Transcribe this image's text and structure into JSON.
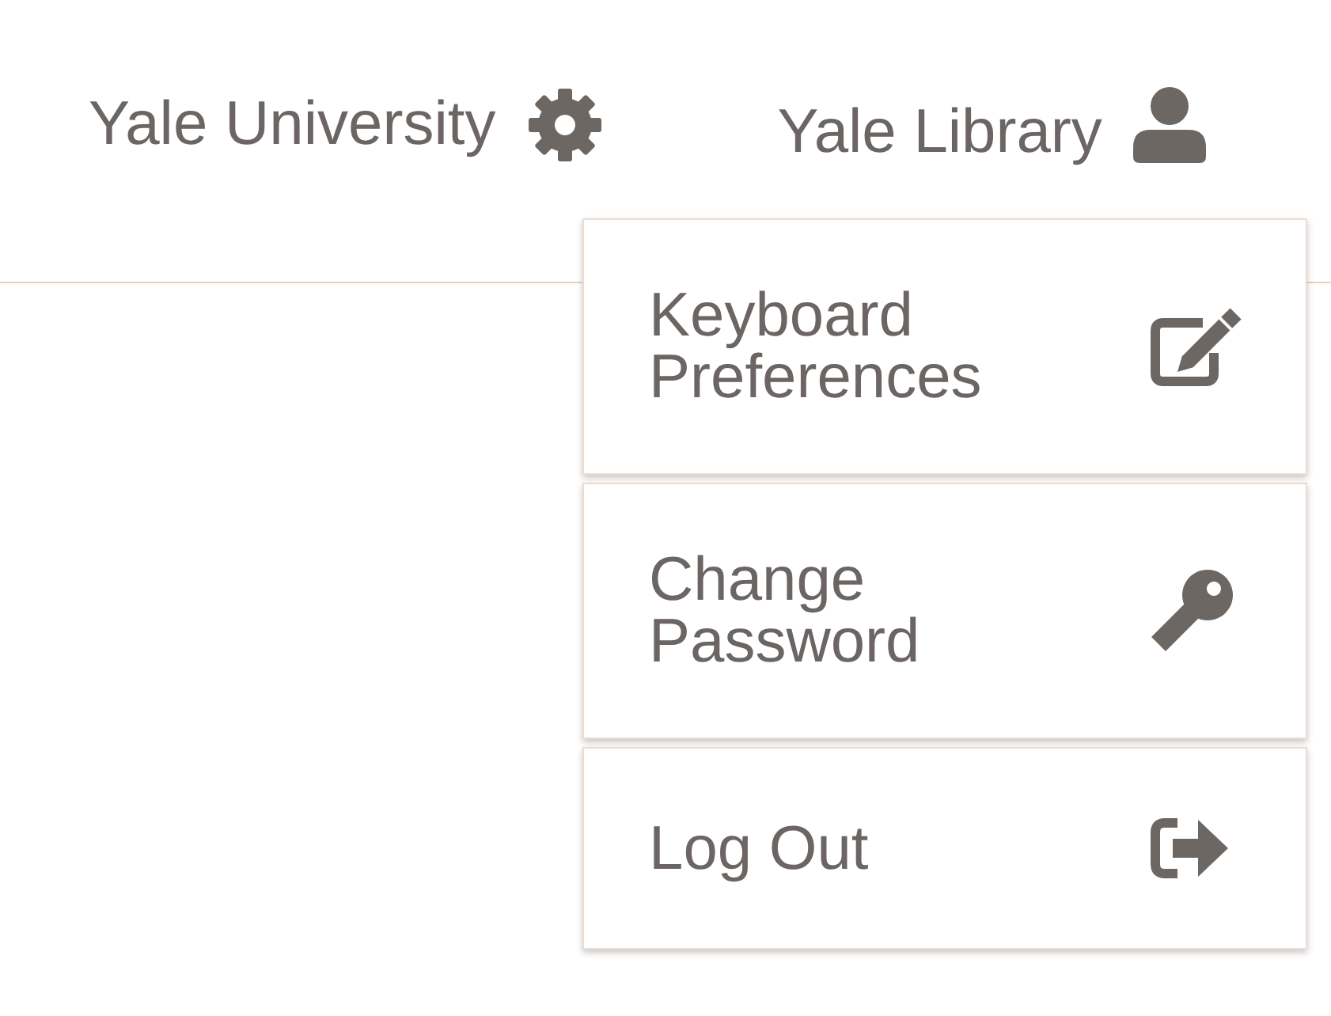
{
  "header": {
    "institution": {
      "label": "Yale University"
    },
    "account": {
      "label": "Yale Library",
      "menu": [
        {
          "label": "Keyboard Preferences"
        },
        {
          "label": "Change Password"
        },
        {
          "label": "Log Out"
        }
      ]
    }
  }
}
